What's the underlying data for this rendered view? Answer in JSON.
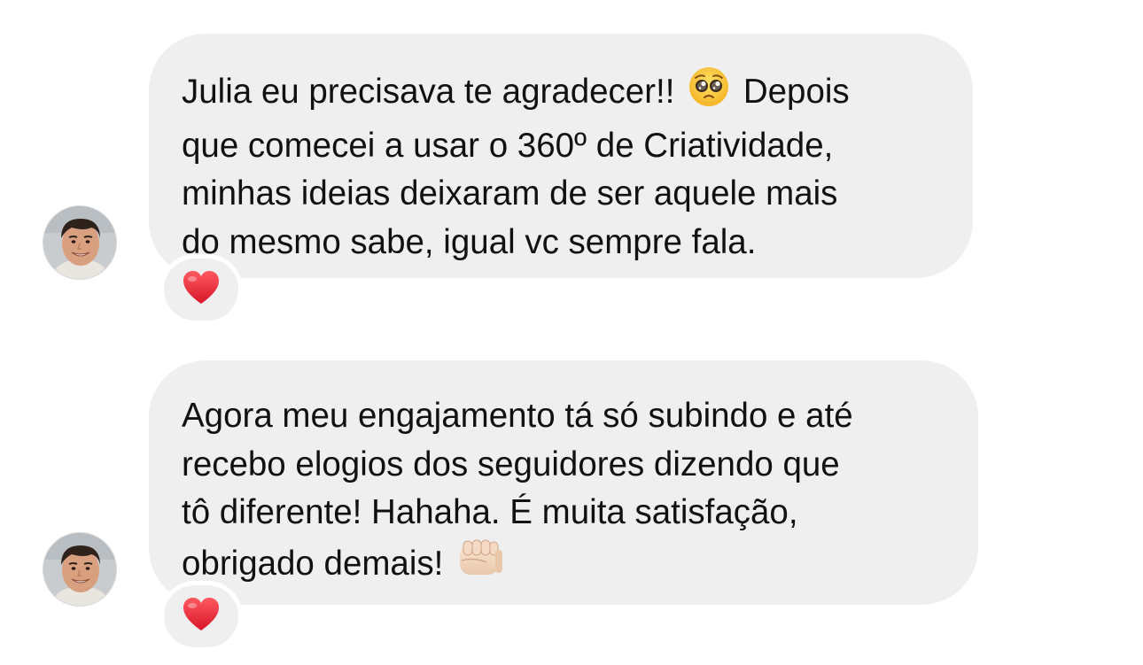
{
  "conversation": {
    "messages": [
      {
        "sender_avatar": "avatar-man-smiling",
        "lines": [
          "Julia eu precisava te agradecer!!",
          "Depois",
          "que comecei a usar o 360º de Criatividade,",
          "minhas ideias deixaram de ser aquele mais",
          "do mesmo sabe, igual vc sempre fala."
        ],
        "inline_emoji": "pleading-face-emoji",
        "reaction": "red-heart-emoji"
      },
      {
        "sender_avatar": "avatar-man-smiling",
        "lines": [
          "Agora meu engajamento tá só subindo e até",
          "recebo elogios dos seguidores dizendo que",
          "tô diferente! Hahaha. É muita satisfação,",
          "obrigado demais!"
        ],
        "inline_emoji": "fist-emoji",
        "reaction": "red-heart-emoji"
      }
    ]
  },
  "colors": {
    "bubble_background": "#efefef",
    "text": "#111111",
    "heart": "#e8242f",
    "background": "#ffffff"
  }
}
